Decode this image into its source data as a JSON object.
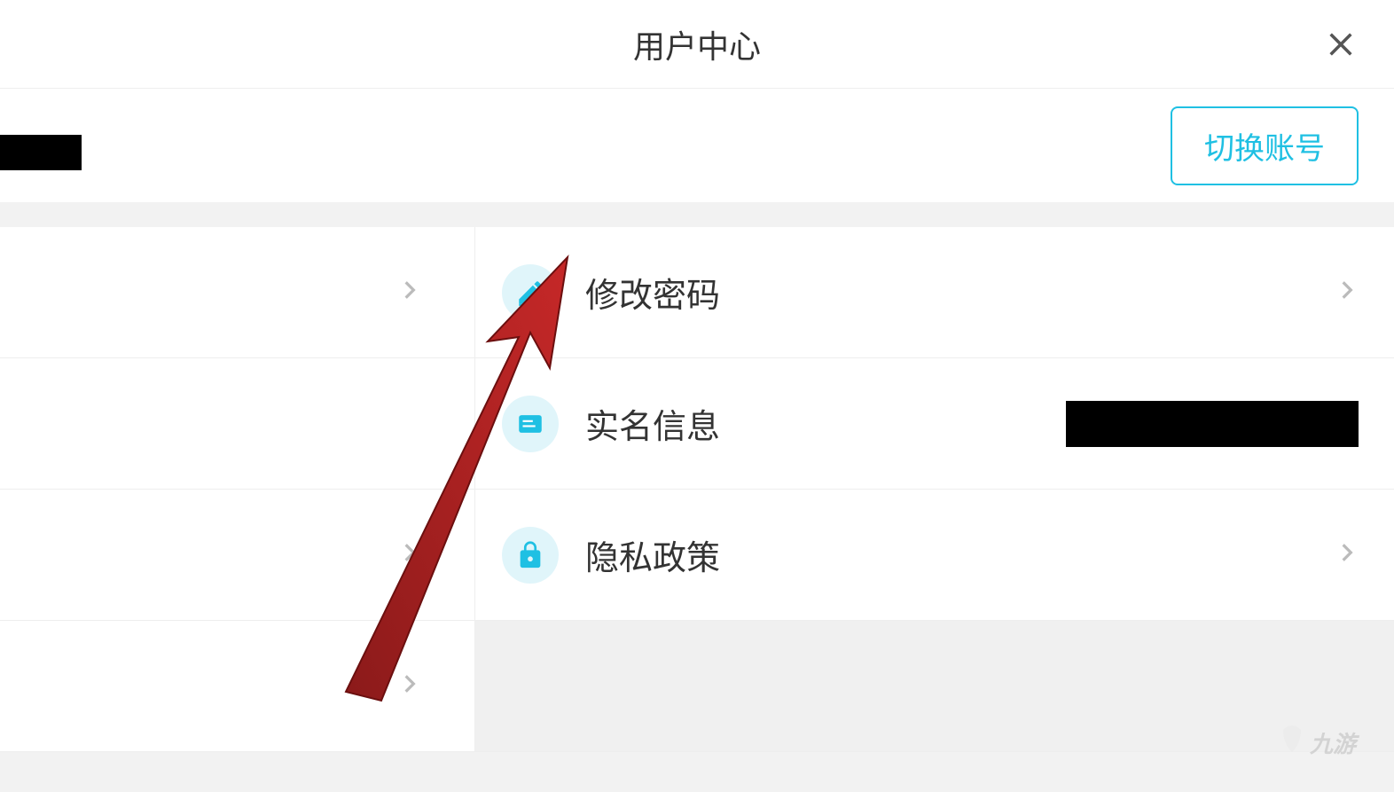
{
  "header": {
    "title": "用户中心"
  },
  "account": {
    "switch_label": "切换账号"
  },
  "menu": {
    "change_password": "修改密码",
    "real_name_info": "实名信息",
    "privacy_policy": "隐私政策"
  },
  "watermark": "九游"
}
